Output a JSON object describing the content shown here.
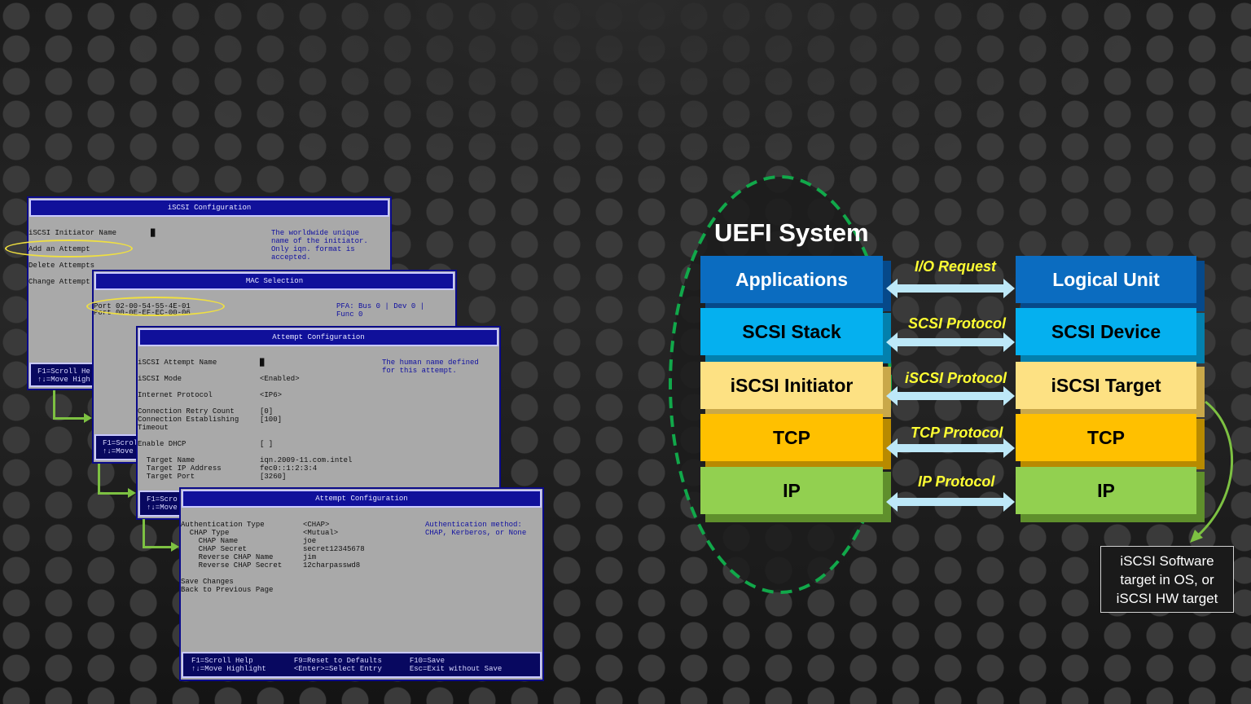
{
  "screens": {
    "iscsi_config": {
      "title": "iSCSI Configuration",
      "rows": [
        "iSCSI Initiator Name",
        "Add an Attempt",
        "Delete Attempts",
        "Change Attempt"
      ],
      "cursor": "█",
      "help": "The worldwide unique\nname of the initiator.\nOnly iqn. format is\naccepted.",
      "footer": "F1=Scroll He\n↑↓=Move High"
    },
    "mac_selection": {
      "title": "MAC Selection",
      "rows": [
        "Port 02-00-54-55-4E-01",
        "Port 00-0E-EF-EC-00-06"
      ],
      "help": "PFA: Bus 0 | Dev 0 |\nFunc 0",
      "footer": "F1=Scrol\n↑↓=Move"
    },
    "attempt_config_1": {
      "title": "Attempt Configuration",
      "labels": "iSCSI Attempt Name\n\niSCSI Mode\n\nInternet Protocol\n\nConnection Retry Count\nConnection Establishing\nTimeout\n\nEnable DHCP\n\n  Target Name\n  Target IP Address\n  Target Port",
      "values": "█\n\n<Enabled>\n\n<IP6>\n\n[0]\n[100]\n\n\n[ ]\n\niqn.2009-11.com.intel\nfec0::1:2:3:4\n[3260]",
      "help": "The human name defined\nfor this attempt.",
      "footer": "F1=Scro\n↑↓=Move"
    },
    "attempt_config_2": {
      "title": "Attempt Configuration",
      "labels": "Authentication Type\n  CHAP Type\n    CHAP Name\n    CHAP Secret\n    Reverse CHAP Name\n    Reverse CHAP Secret\n\nSave Changes\nBack to Previous Page",
      "values": "<CHAP>\n<Mutual>\njoe\nsecret12345678\njim\n12charpasswd8",
      "help": "Authentication method:\nCHAP, Kerberos, or None",
      "footer_col1": "F1=Scroll Help\n↑↓=Move Highlight",
      "footer_col2": "F9=Reset to Defaults\n<Enter>=Select Entry",
      "footer_col3": "F10=Save\nEsc=Exit without Save"
    }
  },
  "diagram": {
    "uefi_label": "UEFI System",
    "left_stack": [
      "Applications",
      "SCSI Stack",
      "iSCSI Initiator",
      "TCP",
      "IP"
    ],
    "right_stack": [
      "Logical Unit",
      "SCSI Device",
      "iSCSI Target",
      "TCP",
      "IP"
    ],
    "protocols": [
      "I/O Request",
      "SCSI Protocol",
      "iSCSI Protocol",
      "TCP Protocol",
      "IP Protocol"
    ],
    "note": "iSCSI Software\ntarget in OS, or\niSCSI HW target",
    "colors": {
      "applications": "#0b6cc0",
      "scsi": "#05b0ef",
      "iscsi": "#fde183",
      "tcp": "#ffc000",
      "ip": "#92d050",
      "dashed_ellipse": "#11a84a",
      "arrow": "#bde8f8",
      "protocol_text": "#ffff33",
      "connector": "#7dc142"
    }
  }
}
